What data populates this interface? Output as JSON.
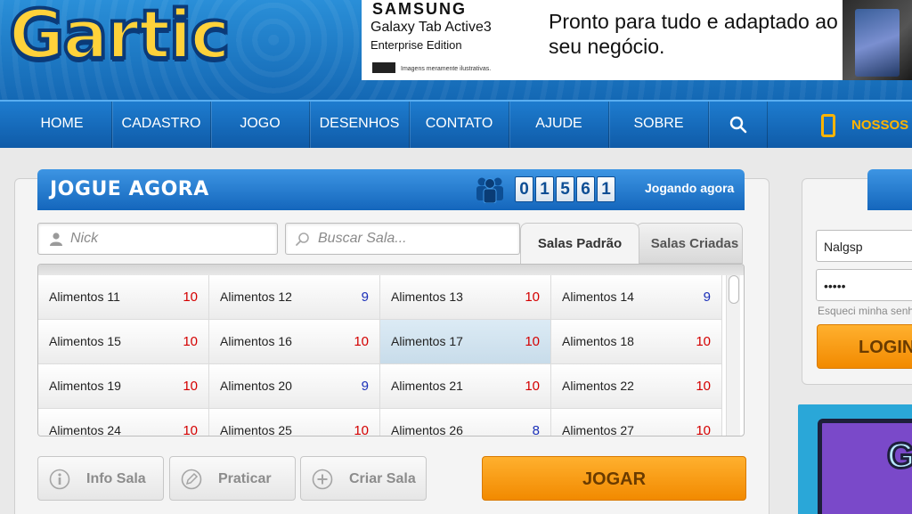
{
  "brand": {
    "logo_text": "Gartic"
  },
  "ad": {
    "brand": "SAMSUNG",
    "product": "Galaxy Tab Active3",
    "edition": "Enterprise Edition",
    "disclaimer": "Imagens meramente ilustrativas.",
    "headline": "Pronto para tudo e adaptado ao seu negócio."
  },
  "nav": {
    "items": [
      {
        "label": "HOME"
      },
      {
        "label": "CADASTRO"
      },
      {
        "label": "JOGO"
      },
      {
        "label": "DESENHOS"
      },
      {
        "label": "CONTATO"
      },
      {
        "label": "AJUDE"
      },
      {
        "label": "SOBRE"
      }
    ],
    "search_icon": "search-icon",
    "promo_label": "NOSSOS A"
  },
  "play_panel": {
    "title": "JOGUE AGORA",
    "players_digits": [
      "0",
      "1",
      "5",
      "6",
      "1"
    ],
    "playing_now_label": "Jogando agora",
    "nick_placeholder": "Nick",
    "search_placeholder": "Buscar Sala...",
    "tabs": [
      {
        "label": "Salas Padrão",
        "active": true
      },
      {
        "label": "Salas Criadas",
        "active": false
      }
    ],
    "rooms": [
      {
        "name": "Alimentos 11",
        "count": "10",
        "full": true
      },
      {
        "name": "Alimentos 12",
        "count": "9",
        "full": false
      },
      {
        "name": "Alimentos 13",
        "count": "10",
        "full": true
      },
      {
        "name": "Alimentos 14",
        "count": "9",
        "full": false
      },
      {
        "name": "Alimentos 15",
        "count": "10",
        "full": true
      },
      {
        "name": "Alimentos 16",
        "count": "10",
        "full": true
      },
      {
        "name": "Alimentos 17",
        "count": "10",
        "full": true,
        "selected": true
      },
      {
        "name": "Alimentos 18",
        "count": "10",
        "full": true
      },
      {
        "name": "Alimentos 19",
        "count": "10",
        "full": true
      },
      {
        "name": "Alimentos 20",
        "count": "9",
        "full": false
      },
      {
        "name": "Alimentos 21",
        "count": "10",
        "full": true
      },
      {
        "name": "Alimentos 22",
        "count": "10",
        "full": true
      },
      {
        "name": "Alimentos 24",
        "count": "10",
        "full": true
      },
      {
        "name": "Alimentos 25",
        "count": "10",
        "full": true
      },
      {
        "name": "Alimentos 26",
        "count": "8",
        "full": false
      },
      {
        "name": "Alimentos 27",
        "count": "10",
        "full": true
      }
    ],
    "buttons": {
      "info": "Info Sala",
      "practice": "Praticar",
      "create": "Criar Sala",
      "play": "JOGAR"
    }
  },
  "login": {
    "username_value": "Nalgsp",
    "password_value": "•••••",
    "forgot_label": "Esqueci minha senha",
    "login_button": "LOGIN"
  },
  "colors": {
    "header_blue": "#1e7ccf",
    "accent_orange": "#f28a00",
    "count_full": "#d40000",
    "count_open": "#1a2fb8"
  }
}
